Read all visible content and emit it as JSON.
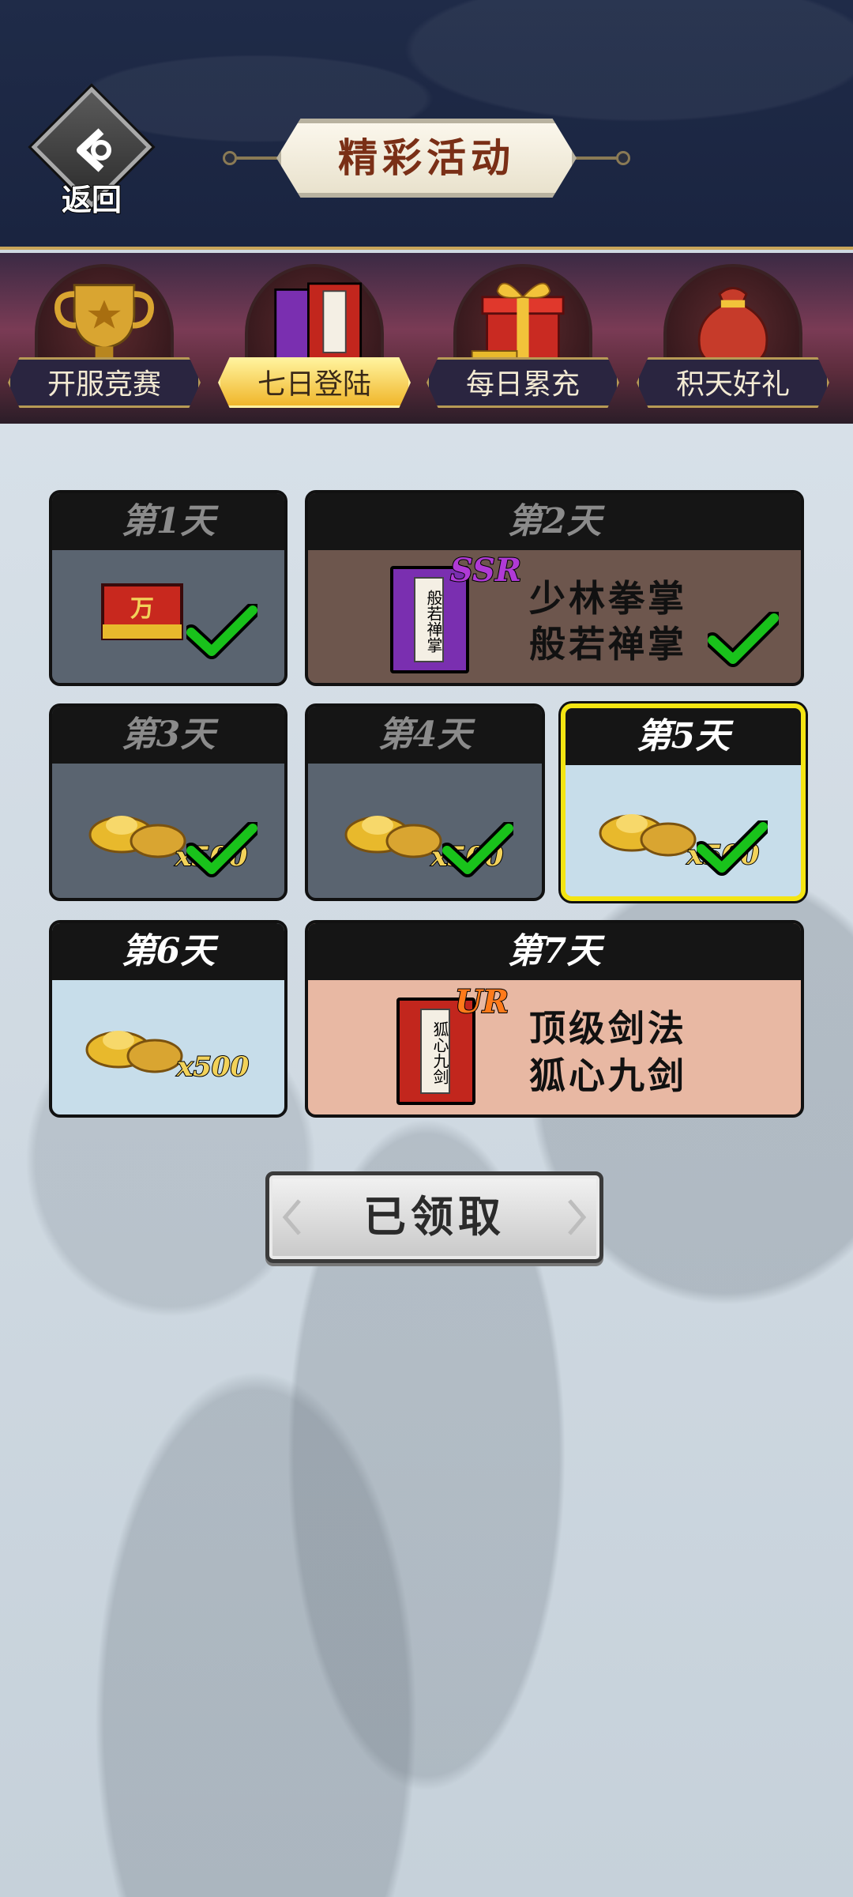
{
  "header": {
    "back_label": "返回",
    "title": "精彩活动"
  },
  "tabs": [
    {
      "label": "开服竞赛",
      "icon": "trophy-icon",
      "active": false
    },
    {
      "label": "七日登陆",
      "icon": "book-icon",
      "active": true
    },
    {
      "label": "每日累充",
      "icon": "gift-box-icon",
      "active": false
    },
    {
      "label": "积天好礼",
      "icon": "money-bag-icon",
      "active": false
    }
  ],
  "days": [
    {
      "label": "第1天",
      "reward": "wan-token",
      "claimed": true
    },
    {
      "label": "第2天",
      "reward": "skill-book",
      "rarity": "SSR",
      "book_title": "般若禅掌",
      "line1": "少林拳掌",
      "line2": "般若禅掌",
      "claimed": true
    },
    {
      "label": "第3天",
      "reward": "gold-ingot",
      "quantity": "x500",
      "claimed": true
    },
    {
      "label": "第4天",
      "reward": "gold-ingot",
      "quantity": "x500",
      "claimed": true
    },
    {
      "label": "第5天",
      "reward": "gold-ingot",
      "quantity": "x500",
      "claimed": true,
      "highlighted": true
    },
    {
      "label": "第6天",
      "reward": "gold-ingot",
      "quantity": "x500",
      "claimed": false
    },
    {
      "label": "第7天",
      "reward": "skill-book",
      "rarity": "UR",
      "book_title": "狐心九剑",
      "line1": "顶级剑法",
      "line2": "狐心九剑",
      "claimed": false
    }
  ],
  "claim_button": "已领取",
  "colors": {
    "header_bg": "#1f2b48",
    "active_tab": "#f0b62b",
    "check": "#19c21b",
    "highlight_border": "#f4e512",
    "ssr": "#b03ad6",
    "ur": "#ff7a1a"
  }
}
